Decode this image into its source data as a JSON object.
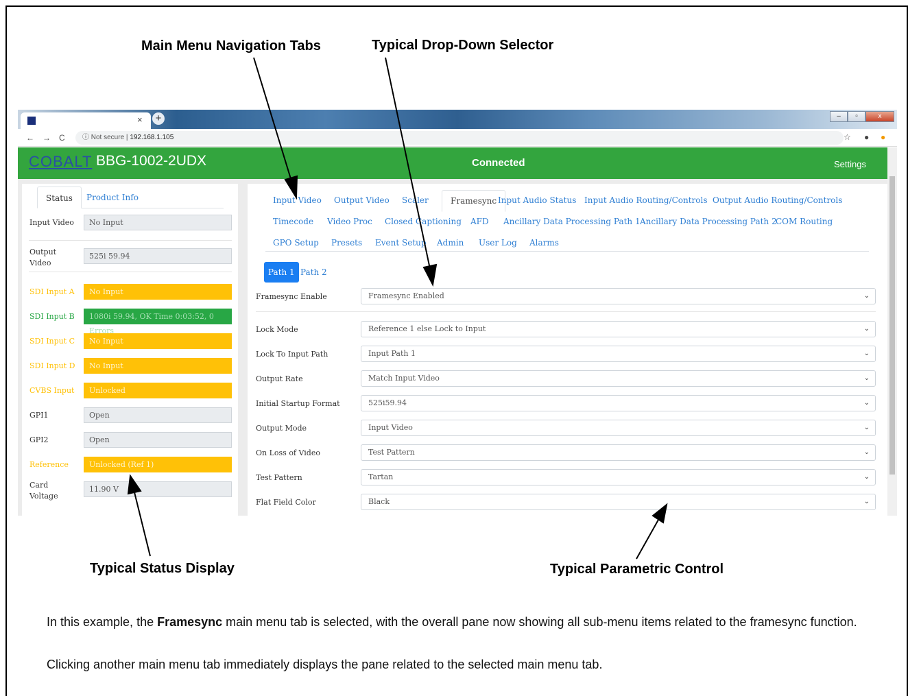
{
  "callouts": {
    "main_menu": "Main Menu Navigation Tabs",
    "dropdown": "Typical Drop-Down Selector",
    "status": "Typical Status Display",
    "parametric": "Typical Parametric Control"
  },
  "browser": {
    "tab_close": "×",
    "tab_new": "+",
    "win_min": "–",
    "win_max": "▫",
    "win_close": "x",
    "nav_back": "←",
    "nav_forward": "→",
    "nav_reload": "C",
    "security": "ⓘ Not secure",
    "separator": "|",
    "url": "192.168.1.105",
    "star": "☆",
    "account": "●",
    "update": "●"
  },
  "app": {
    "logo": "COBALT",
    "device": "BBG-1002-2UDX",
    "status": "Connected",
    "settings": "Settings",
    "colors": {
      "green": "#33a53e",
      "warn": "#ffc107",
      "ok": "#28a745",
      "accent": "#1a7ef2"
    }
  },
  "left_panel": {
    "tabs": [
      {
        "label": "Status"
      },
      {
        "label": "Product Info"
      }
    ],
    "rows": [
      {
        "label": "Input Video",
        "value": "No Input",
        "state": "normal"
      },
      {
        "label": "Output Video",
        "value": "525i 59.94",
        "state": "normal"
      },
      {
        "label": "SDI Input A",
        "value": "No Input",
        "state": "warn"
      },
      {
        "label": "SDI Input B",
        "value": "1080i 59.94, OK Time 0:03:52, 0 Errors",
        "state": "ok"
      },
      {
        "label": "SDI Input C",
        "value": "No Input",
        "state": "warn"
      },
      {
        "label": "SDI Input D",
        "value": "No Input",
        "state": "warn"
      },
      {
        "label": "CVBS Input",
        "value": "Unlocked",
        "state": "warn"
      },
      {
        "label": "GPI1",
        "value": "Open",
        "state": "normal"
      },
      {
        "label": "GPI2",
        "value": "Open",
        "state": "normal"
      },
      {
        "label": "Reference",
        "value": "Unlocked (Ref 1)",
        "state": "warn"
      },
      {
        "label": "Card Voltage",
        "value": "11.90 V",
        "state": "normal"
      }
    ]
  },
  "main_tabs": [
    "Input Video",
    "Output Video",
    "Scaler",
    "Framesync",
    "Input Audio Status",
    "Input Audio Routing/Controls",
    "Output Audio Routing/Controls",
    "Timecode",
    "Video Proc",
    "Closed Captioning",
    "AFD",
    "Ancillary Data Processing Path 1",
    "Ancillary Data Processing Path 2",
    "COM Routing",
    "GPO Setup",
    "Presets",
    "Event Setup",
    "Admin",
    "User Log",
    "Alarms"
  ],
  "active_tab": "Framesync",
  "path_tabs": [
    "Path 1",
    "Path 2"
  ],
  "controls": [
    {
      "label": "Framesync Enable",
      "value": "Framesync Enabled"
    },
    {
      "label": "Lock Mode",
      "value": "Reference 1 else Lock to Input"
    },
    {
      "label": "Lock To Input Path",
      "value": "Input Path 1"
    },
    {
      "label": "Output Rate",
      "value": "Match Input Video"
    },
    {
      "label": "Initial Startup Format",
      "value": "525i59.94"
    },
    {
      "label": "Output Mode",
      "value": "Input Video"
    },
    {
      "label": "On Loss of Video",
      "value": "Test Pattern"
    },
    {
      "label": "Test Pattern",
      "value": "Tartan"
    },
    {
      "label": "Flat Field Color",
      "value": "Black"
    }
  ],
  "chevron": "⌄",
  "description": {
    "p1_pre": "In this example, the ",
    "p1_bold": "Framesync",
    "p1_post": " main menu tab is selected, with the overall pane now showing all sub-menu items related to the framesync function.",
    "p2": "Clicking another main menu tab immediately displays the pane related to the selected main menu tab."
  }
}
